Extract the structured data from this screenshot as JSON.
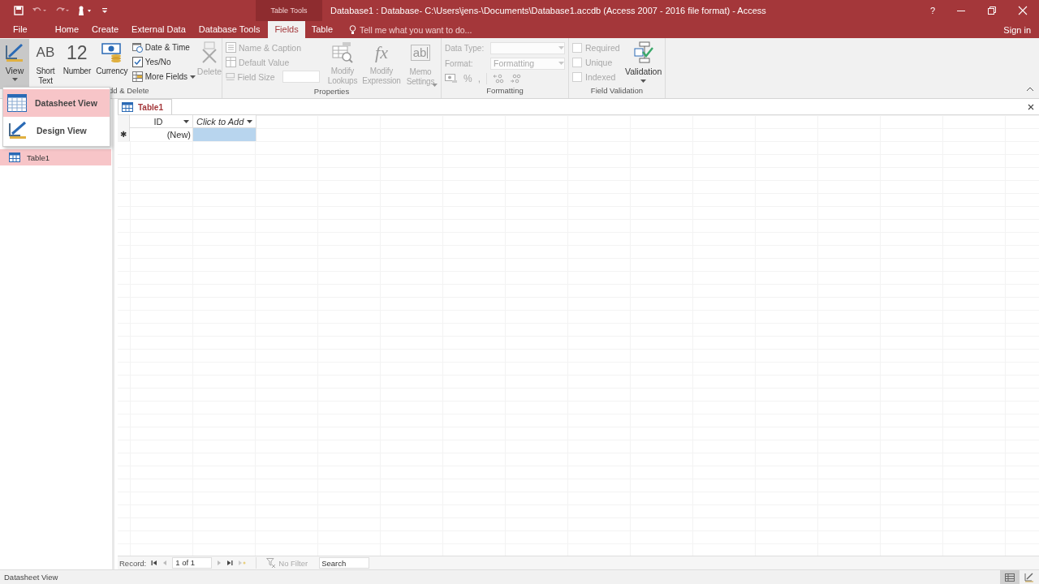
{
  "window": {
    "context_label": "Table Tools",
    "title": "Database1 : Database- C:\\Users\\jens-\\Documents\\Database1.accdb (Access 2007 - 2016 file format) - Access",
    "help": "?",
    "sign_in": "Sign in"
  },
  "tabs": [
    {
      "label": "File",
      "selected": false
    },
    {
      "label": "Home",
      "selected": false
    },
    {
      "label": "Create",
      "selected": false
    },
    {
      "label": "External Data",
      "selected": false
    },
    {
      "label": "Database Tools",
      "selected": false
    },
    {
      "label": "Fields",
      "selected": true
    },
    {
      "label": "Table",
      "selected": false
    }
  ],
  "tell_me": {
    "placeholder": "Tell me what you want to do..."
  },
  "ribbon": {
    "view": {
      "label": "View",
      "pressed": true
    },
    "add_delete": {
      "label": "dd & Delete",
      "fields": [
        {
          "kind": "text",
          "glyph": "AB",
          "label": "Short Text"
        },
        {
          "kind": "number",
          "glyph": "12",
          "label": "Number"
        },
        {
          "kind": "currency",
          "label": "Currency"
        }
      ],
      "small": [
        {
          "kind": "date",
          "label": "Date & Time"
        },
        {
          "kind": "yesno",
          "label": "Yes/No"
        },
        {
          "kind": "more",
          "label": "More Fields",
          "dropdown": true
        }
      ],
      "delete": {
        "label": "Delete",
        "disabled": true
      }
    },
    "properties": {
      "label": "Properties",
      "small": [
        {
          "kind": "caption",
          "label": "Name & Caption",
          "disabled": true
        },
        {
          "kind": "default",
          "label": "Default Value",
          "disabled": true
        },
        {
          "kind": "size",
          "label": "Field Size",
          "disabled": true
        }
      ],
      "large": [
        {
          "kind": "lookups",
          "label": "Modify Lookups",
          "disabled": true
        },
        {
          "kind": "expression",
          "glyph": "fx",
          "label": "Modify Expression",
          "disabled": true
        },
        {
          "kind": "memo",
          "glyph": "ab",
          "label": "Memo Settings",
          "dropdown": true,
          "disabled": true
        }
      ]
    },
    "formatting": {
      "label": "Formatting",
      "data_type": {
        "label": "Data Type:",
        "disabled": true
      },
      "format": {
        "label": "Format:",
        "value": "Formatting",
        "disabled": true
      },
      "buttons": [
        {
          "kind": "currency"
        },
        {
          "kind": "glyph",
          "glyph": "%"
        },
        {
          "kind": "glyph",
          "glyph": ","
        },
        {
          "kind": "increase"
        },
        {
          "kind": "decrease"
        }
      ]
    },
    "validation": {
      "label": "Field Validation",
      "checks": [
        {
          "label": "Required",
          "checked": false,
          "disabled": true
        },
        {
          "label": "Unique",
          "checked": false,
          "disabled": true
        },
        {
          "label": "Indexed",
          "checked": false,
          "disabled": true
        }
      ],
      "button": {
        "label": "Validation",
        "dropdown": true
      }
    }
  },
  "view_menu": [
    {
      "kind": "datasheet",
      "label": "Datasheet View",
      "selected": true
    },
    {
      "kind": "design",
      "label": "Design View",
      "selected": false
    }
  ],
  "nav": {
    "items": [
      {
        "label": "Table1",
        "selected": true
      }
    ]
  },
  "document": {
    "tabs": [
      {
        "label": "Table1",
        "selected": true
      }
    ],
    "columns": [
      {
        "kind": "field",
        "label": "ID"
      },
      {
        "kind": "add",
        "label": "Click to Add"
      }
    ],
    "rows": [
      {
        "marker": "✱",
        "cells": [
          {
            "text": "(New)",
            "selected": false
          },
          {
            "selected": true
          }
        ]
      }
    ]
  },
  "record_bar": {
    "label": "Record:",
    "position": "1 of 1",
    "filter": "No Filter",
    "search": {
      "placeholder": "Search"
    }
  },
  "status_bar": {
    "text": "Datasheet View",
    "views": [
      {
        "kind": "datasheet",
        "selected": true
      },
      {
        "kind": "design",
        "selected": false
      }
    ]
  }
}
